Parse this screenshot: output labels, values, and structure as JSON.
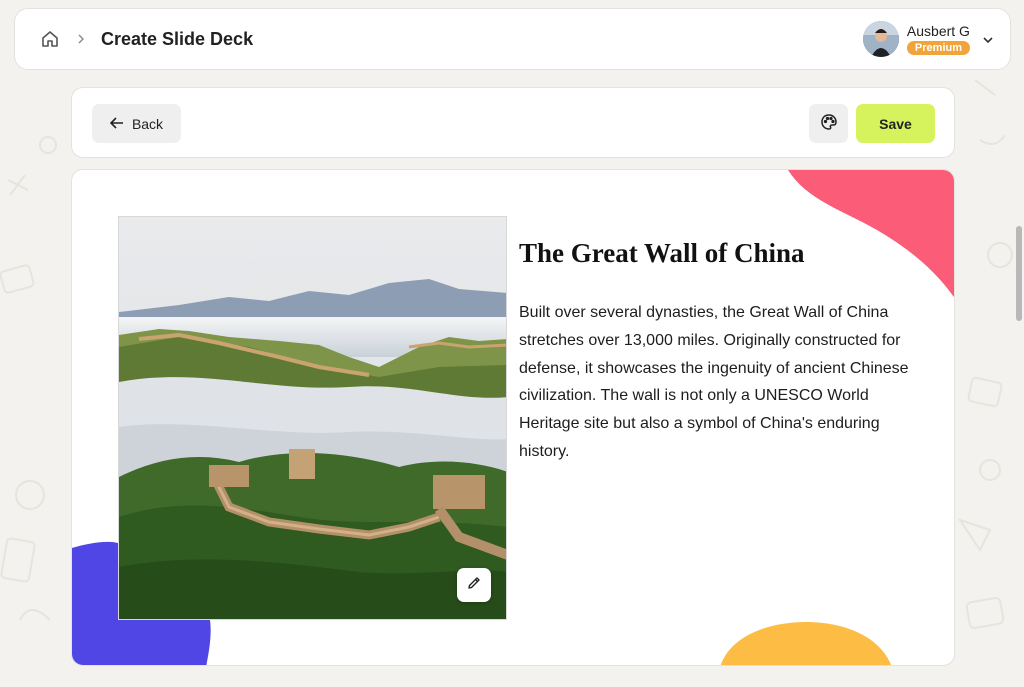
{
  "header": {
    "page_title": "Create Slide Deck",
    "user_name": "Ausbert G",
    "badge": "Premium"
  },
  "toolbar": {
    "back_label": "Back",
    "save_label": "Save"
  },
  "slide": {
    "title": "The Great Wall of China",
    "body": "Built over several dynasties, the Great Wall of China stretches over 13,000 miles. Originally constructed for defense, it showcases the ingenuity of ancient Chinese civilization. The wall is not only a UNESCO World Heritage site but also a symbol of China's enduring history.",
    "image_subject": "great-wall-photo"
  },
  "colors": {
    "blob_pink": "#fb5c77",
    "blob_blue": "#5046e5",
    "blob_yellow": "#fdbd44",
    "save_button": "#d6f25c",
    "premium_badge": "#f0a43a"
  },
  "icons": [
    "home-icon",
    "chevron-right-icon",
    "arrow-left-icon",
    "palette-icon",
    "pencil-icon",
    "chevron-down-icon"
  ]
}
